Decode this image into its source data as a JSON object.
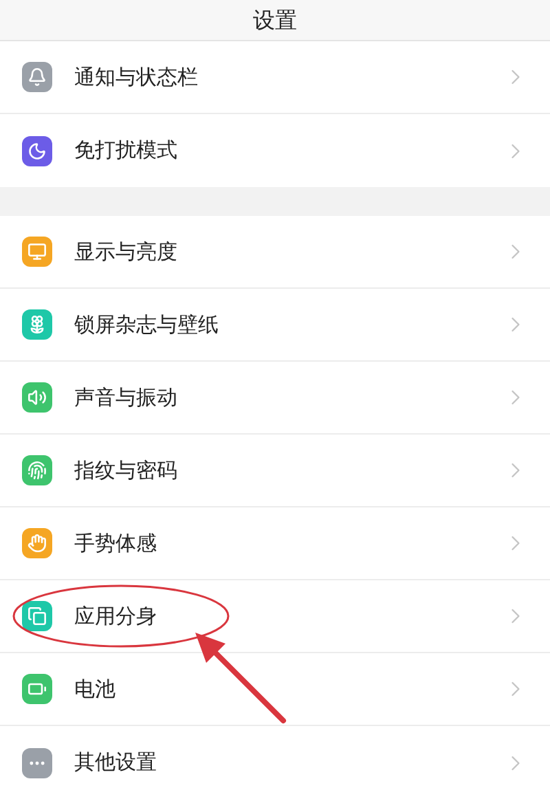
{
  "header": {
    "title": "设置"
  },
  "groups": [
    {
      "items": [
        {
          "label": "通知与状态栏",
          "kind": "bell",
          "color": "#9aa0a8",
          "circled": false
        },
        {
          "label": "免打扰模式",
          "kind": "moon",
          "color": "#6c5ce7",
          "circled": false
        }
      ]
    },
    {
      "items": [
        {
          "label": "显示与亮度",
          "kind": "monitor",
          "color": "#f5a623",
          "circled": false
        },
        {
          "label": "锁屏杂志与壁纸",
          "kind": "flower",
          "color": "#1ec8a8",
          "circled": false
        },
        {
          "label": "声音与振动",
          "kind": "sound",
          "color": "#3ec46d",
          "circled": false
        },
        {
          "label": "指纹与密码",
          "kind": "fingerprint",
          "color": "#3ec46d",
          "circled": false
        },
        {
          "label": "手势体感",
          "kind": "hand",
          "color": "#f5a623",
          "circled": false
        },
        {
          "label": "应用分身",
          "kind": "copy",
          "color": "#1ec8a8",
          "circled": true
        },
        {
          "label": "电池",
          "kind": "battery",
          "color": "#3ec46d",
          "circled": false
        },
        {
          "label": "其他设置",
          "kind": "more",
          "color": "#9aa0a8",
          "circled": false
        }
      ]
    }
  ]
}
